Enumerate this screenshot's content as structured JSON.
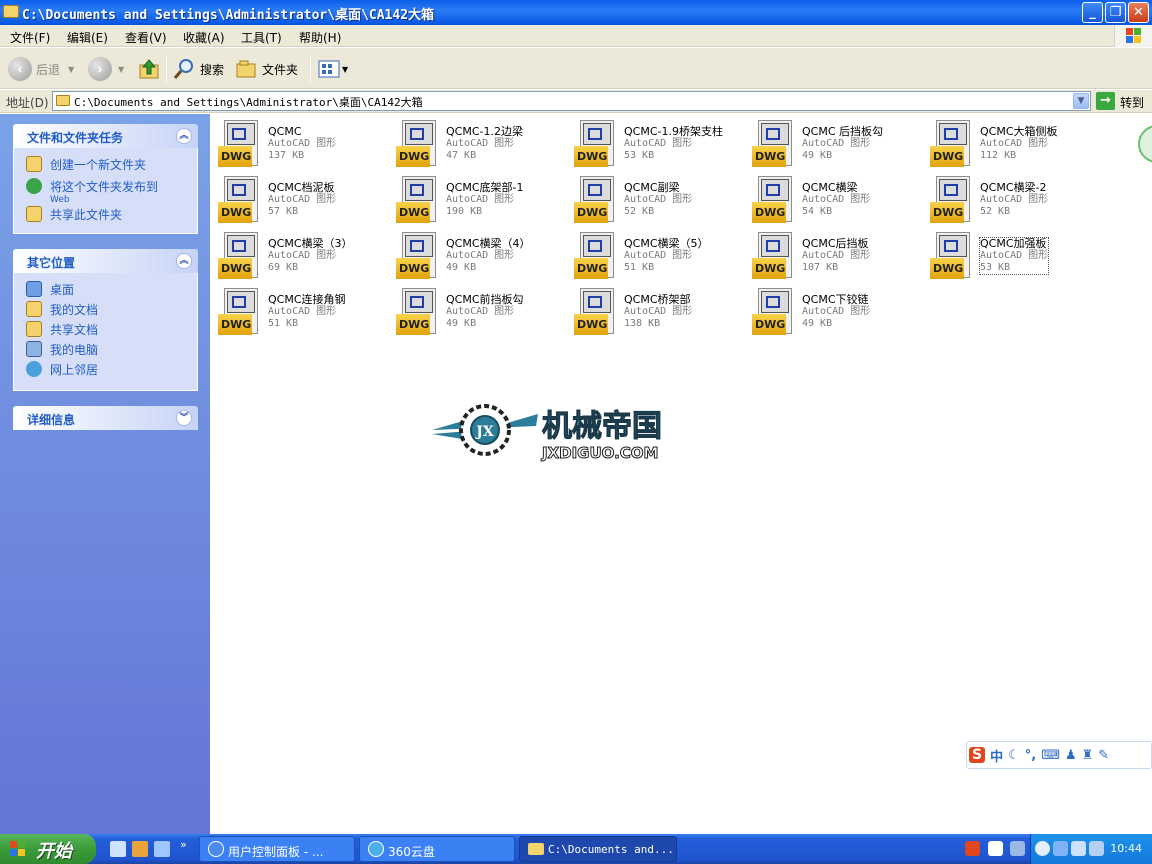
{
  "window": {
    "title": "C:\\Documents and Settings\\Administrator\\桌面\\CA142大箱",
    "minimize_label": "_",
    "maximize_label": "❐",
    "close_label": "✕"
  },
  "menu": [
    "文件(F)",
    "编辑(E)",
    "查看(V)",
    "收藏(A)",
    "工具(T)",
    "帮助(H)"
  ],
  "toolbar": {
    "back_label": "后退",
    "search_label": "搜索",
    "folders_label": "文件夹"
  },
  "address": {
    "label": "地址(D)",
    "path": "C:\\Documents and Settings\\Administrator\\桌面\\CA142大箱",
    "go_label": "转到"
  },
  "taskpane": {
    "file_tasks": {
      "title": "文件和文件夹任务",
      "items": [
        {
          "label": "创建一个新文件夹",
          "icon": "new-folder-icon"
        },
        {
          "label": "将这个文件夹发布到",
          "sub": "Web",
          "icon": "publish-web-icon"
        },
        {
          "label": "共享此文件夹",
          "icon": "share-folder-icon"
        }
      ]
    },
    "other_places": {
      "title": "其它位置",
      "items": [
        {
          "label": "桌面",
          "icon": "desktop-icon"
        },
        {
          "label": "我的文档",
          "icon": "my-documents-icon"
        },
        {
          "label": "共享文档",
          "icon": "shared-documents-icon"
        },
        {
          "label": "我的电脑",
          "icon": "my-computer-icon"
        },
        {
          "label": "网上邻居",
          "icon": "network-places-icon"
        }
      ]
    },
    "details": {
      "title": "详细信息"
    }
  },
  "files": [
    {
      "name": "QCMC",
      "type": "AutoCAD 图形",
      "size": "137 KB"
    },
    {
      "name": "QCMC-1.2边梁",
      "type": "AutoCAD 图形",
      "size": "47 KB"
    },
    {
      "name": "QCMC-1.9桥架支柱",
      "type": "AutoCAD 图形",
      "size": "53 KB"
    },
    {
      "name": "QCMC 后挡板勾",
      "type": "AutoCAD 图形",
      "size": "49 KB"
    },
    {
      "name": "QCMC大箱侧板",
      "type": "AutoCAD 图形",
      "size": "112 KB"
    },
    {
      "name": "QCMC档泥板",
      "type": "AutoCAD 图形",
      "size": "57 KB"
    },
    {
      "name": "QCMC底架部-1",
      "type": "AutoCAD 图形",
      "size": "190 KB"
    },
    {
      "name": "QCMC副梁",
      "type": "AutoCAD 图形",
      "size": "52 KB"
    },
    {
      "name": "QCMC横梁",
      "type": "AutoCAD 图形",
      "size": "54 KB"
    },
    {
      "name": "QCMC横梁-2",
      "type": "AutoCAD 图形",
      "size": "52 KB"
    },
    {
      "name": "QCMC横梁（3）",
      "type": "AutoCAD 图形",
      "size": "69 KB"
    },
    {
      "name": "QCMC横梁（4）",
      "type": "AutoCAD 图形",
      "size": "49 KB"
    },
    {
      "name": "QCMC横梁（5）",
      "type": "AutoCAD 图形",
      "size": "51 KB"
    },
    {
      "name": "QCMC后挡板",
      "type": "AutoCAD 图形",
      "size": "107 KB"
    },
    {
      "name": "QCMC加强板",
      "type": "AutoCAD 图形",
      "size": "53 KB",
      "selected": true
    },
    {
      "name": "QCMC连接角钢",
      "type": "AutoCAD 图形",
      "size": "51 KB"
    },
    {
      "name": "QCMC前挡板勾",
      "type": "AutoCAD 图形",
      "size": "49 KB"
    },
    {
      "name": "QCMC桥架部",
      "type": "AutoCAD 图形",
      "size": "138 KB"
    },
    {
      "name": "QCMC下铰链",
      "type": "AutoCAD 图形",
      "size": "49 KB"
    }
  ],
  "file_icon_tag": "DWG",
  "watermark": {
    "cn": "机械帝国",
    "en": "JXDIGUO.COM",
    "emblem": "JX"
  },
  "ime": {
    "s": "S",
    "lang": "中"
  },
  "taskbar": {
    "start_label": "开始",
    "tasks": [
      {
        "label": "用户控制面板 - ...",
        "active": false
      },
      {
        "label": "360云盘",
        "active": false
      },
      {
        "label": "C:\\Documents and...",
        "active": true
      }
    ],
    "clock": "10:44"
  }
}
